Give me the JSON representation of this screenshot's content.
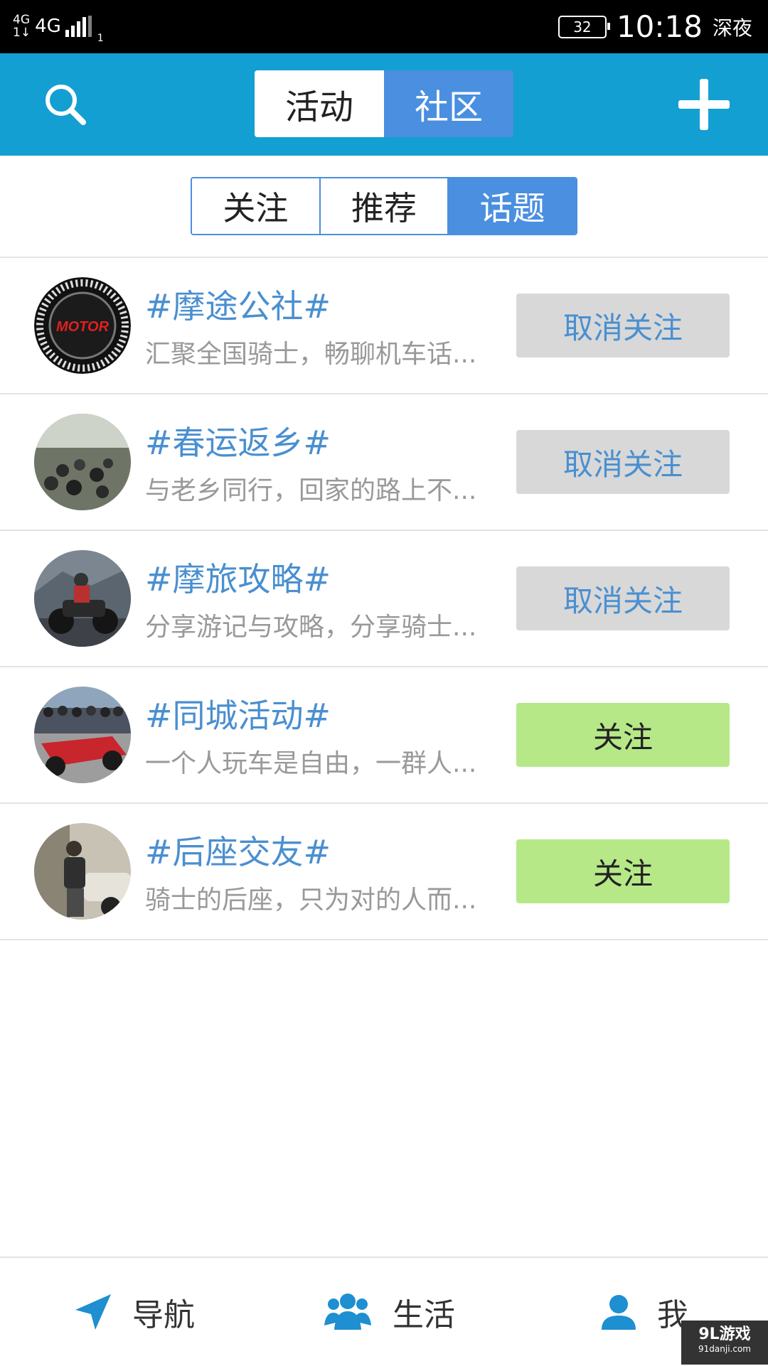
{
  "status_bar": {
    "net_small_top": "4G",
    "net_small_bottom": "1↓",
    "network": "4G",
    "sim": "1",
    "battery": "32",
    "time": "10:18",
    "period": "深夜"
  },
  "header": {
    "search_icon": "search-icon",
    "plus_icon": "plus-icon",
    "tabs": [
      {
        "label": "活动",
        "active": true
      },
      {
        "label": "社区",
        "active": false
      }
    ]
  },
  "subtabs": [
    {
      "label": "关注",
      "active": false
    },
    {
      "label": "推荐",
      "active": false
    },
    {
      "label": "话题",
      "active": true
    }
  ],
  "topics": [
    {
      "title": "#摩途公社#",
      "desc": "汇聚全国骑士，畅聊机车话...",
      "button": "取消关注",
      "following": true,
      "avatar_text": "MOTOR"
    },
    {
      "title": "#春运返乡#",
      "desc": "与老乡同行，回家的路上不...",
      "button": "取消关注",
      "following": true
    },
    {
      "title": "#摩旅攻略#",
      "desc": "分享游记与攻略，分享骑士...",
      "button": "取消关注",
      "following": true
    },
    {
      "title": "#同城活动#",
      "desc": "一个人玩车是自由，一群人...",
      "button": "关注",
      "following": false
    },
    {
      "title": "#后座交友#",
      "desc": "骑士的后座，只为对的人而...",
      "button": "关注",
      "following": false
    }
  ],
  "bottom_nav": [
    {
      "label": "导航",
      "icon": "navigation-arrow-icon"
    },
    {
      "label": "生活",
      "icon": "people-group-icon"
    },
    {
      "label": "我",
      "icon": "user-icon"
    }
  ],
  "watermark": {
    "main": "9L游戏",
    "sub": "91danji.com"
  },
  "colors": {
    "header_bg": "#139fd2",
    "accent_blue": "#4a8fe0",
    "topic_blue": "#4a8fd0",
    "unfollow_bg": "#d8d8d8",
    "follow_bg": "#b6e888"
  }
}
